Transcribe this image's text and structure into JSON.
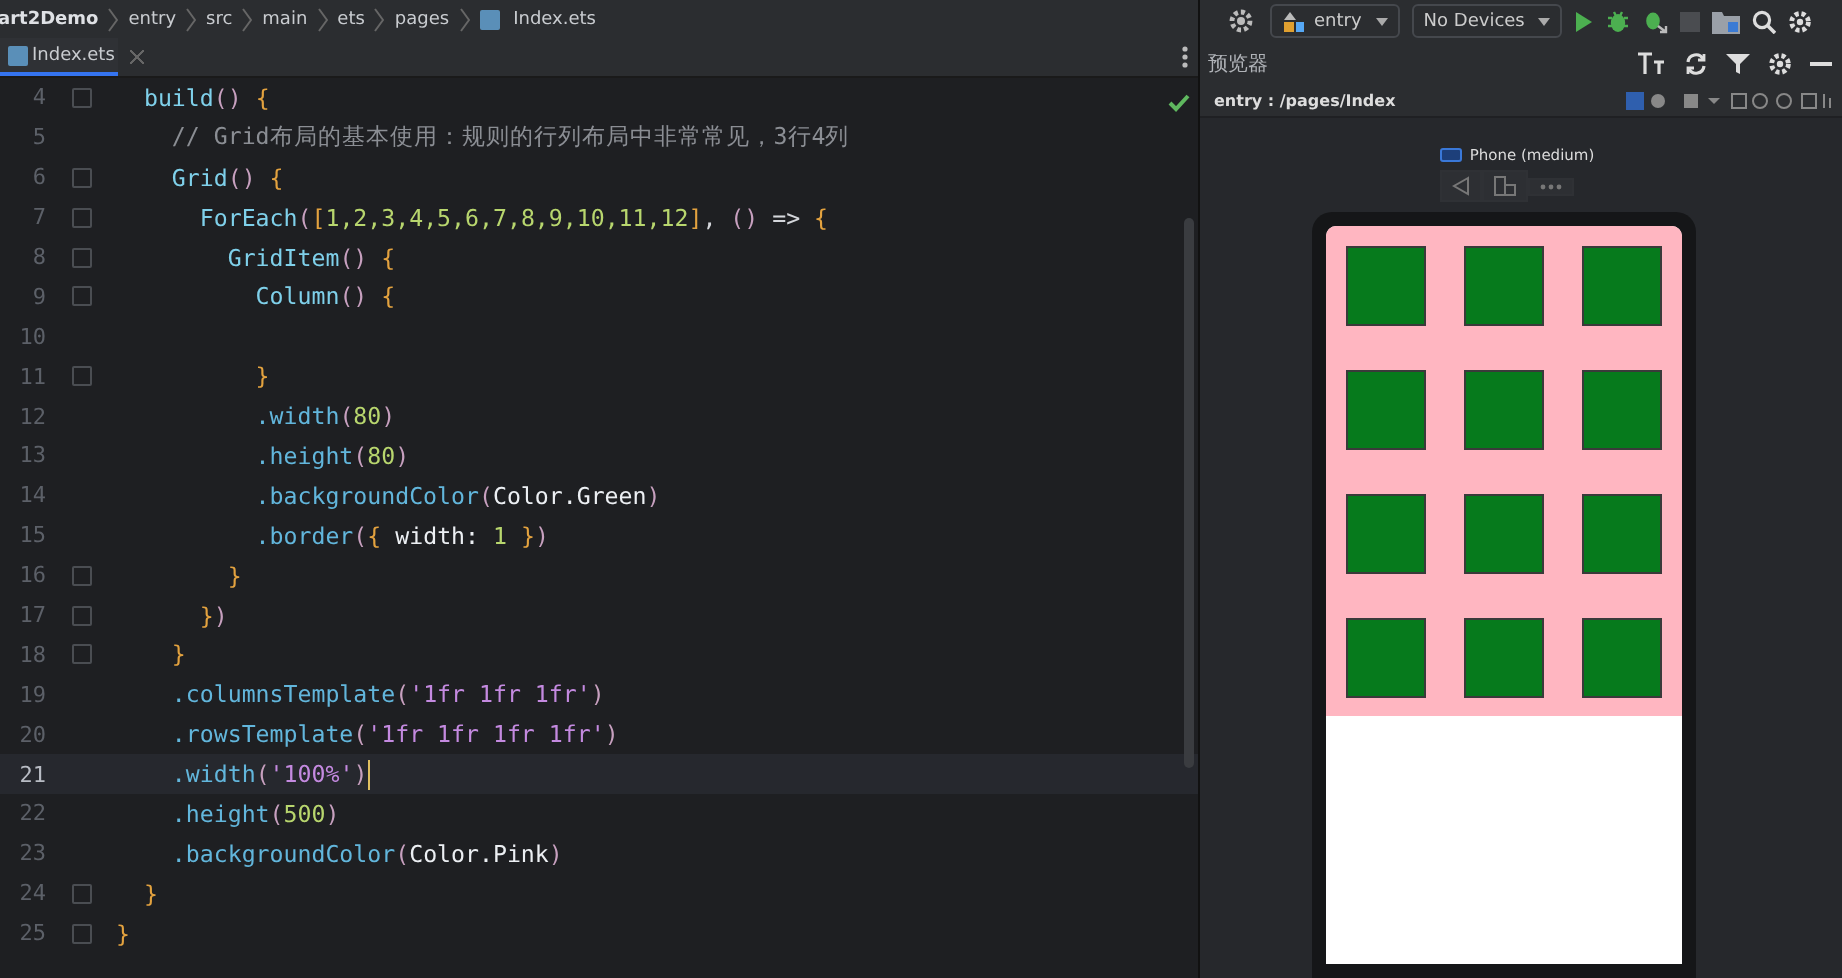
{
  "breadcrumb": [
    "art2Demo",
    "entry",
    "src",
    "main",
    "ets",
    "pages",
    "Index.ets"
  ],
  "tabs": [
    {
      "label": "Index.ets",
      "selected": true
    }
  ],
  "editor": {
    "lines": [
      {
        "number": "4",
        "fold": true,
        "current": false,
        "tokens": [
          {
            "kind": "fn",
            "text": "  build"
          },
          {
            "kind": "paren",
            "text": "() "
          },
          {
            "kind": "brace",
            "text": "{"
          }
        ]
      },
      {
        "number": "5",
        "fold": false,
        "current": false,
        "tokens": [
          {
            "kind": "comment",
            "text": "    // Grid布局的基本使用：规则的行列布局中非常常见，3行4列"
          }
        ]
      },
      {
        "number": "6",
        "fold": true,
        "current": false,
        "tokens": [
          {
            "kind": "fn",
            "text": "    Grid"
          },
          {
            "kind": "paren",
            "text": "() "
          },
          {
            "kind": "brace",
            "text": "{"
          }
        ]
      },
      {
        "number": "7",
        "fold": true,
        "current": false,
        "tokens": [
          {
            "kind": "fn",
            "text": "      ForEach"
          },
          {
            "kind": "paren",
            "text": "("
          },
          {
            "kind": "brace",
            "text": "["
          },
          {
            "kind": "num",
            "text": "1,2,3,4,5,6,7,8,9,10,11,12"
          },
          {
            "kind": "brace",
            "text": "]"
          },
          {
            "kind": "plain",
            "text": ", "
          },
          {
            "kind": "paren",
            "text": "()"
          },
          {
            "kind": "plain",
            "text": " => "
          },
          {
            "kind": "brace",
            "text": "{"
          }
        ]
      },
      {
        "number": "8",
        "fold": true,
        "current": false,
        "tokens": [
          {
            "kind": "fn",
            "text": "        GridItem"
          },
          {
            "kind": "paren",
            "text": "() "
          },
          {
            "kind": "brace",
            "text": "{"
          }
        ]
      },
      {
        "number": "9",
        "fold": true,
        "current": false,
        "tokens": [
          {
            "kind": "fn",
            "text": "          Column"
          },
          {
            "kind": "paren",
            "text": "() "
          },
          {
            "kind": "brace",
            "text": "{"
          }
        ]
      },
      {
        "number": "10",
        "fold": false,
        "current": false
      },
      {
        "number": "11",
        "fold": true,
        "current": false,
        "tokens": [
          {
            "kind": "brace",
            "text": "          }"
          }
        ]
      },
      {
        "number": "12",
        "fold": false,
        "current": false,
        "tokens": [
          {
            "kind": "method",
            "text": "          .width"
          },
          {
            "kind": "paren",
            "text": "("
          },
          {
            "kind": "num",
            "text": "80"
          },
          {
            "kind": "paren",
            "text": ")"
          }
        ]
      },
      {
        "number": "13",
        "fold": false,
        "current": false,
        "tokens": [
          {
            "kind": "method",
            "text": "          .height"
          },
          {
            "kind": "paren",
            "text": "("
          },
          {
            "kind": "num",
            "text": "80"
          },
          {
            "kind": "paren",
            "text": ")"
          }
        ]
      },
      {
        "number": "14",
        "fold": false,
        "current": false,
        "tokens": [
          {
            "kind": "method",
            "text": "          .backgroundColor"
          },
          {
            "kind": "paren",
            "text": "("
          },
          {
            "kind": "ident",
            "text": "Color.Green"
          },
          {
            "kind": "paren",
            "text": ")"
          }
        ]
      },
      {
        "number": "15",
        "fold": false,
        "current": false,
        "tokens": [
          {
            "kind": "method",
            "text": "          .border"
          },
          {
            "kind": "paren",
            "text": "("
          },
          {
            "kind": "brace",
            "text": "{ "
          },
          {
            "kind": "ident",
            "text": "width: "
          },
          {
            "kind": "num",
            "text": "1"
          },
          {
            "kind": "brace",
            "text": " }"
          },
          {
            "kind": "paren",
            "text": ")"
          }
        ]
      },
      {
        "number": "16",
        "fold": true,
        "current": false,
        "tokens": [
          {
            "kind": "brace",
            "text": "        }"
          }
        ]
      },
      {
        "number": "17",
        "fold": true,
        "current": false,
        "tokens": [
          {
            "kind": "brace",
            "text": "      }"
          },
          {
            "kind": "paren",
            "text": ")"
          }
        ]
      },
      {
        "number": "18",
        "fold": true,
        "current": false,
        "tokens": [
          {
            "kind": "brace",
            "text": "    }"
          }
        ]
      },
      {
        "number": "19",
        "fold": false,
        "current": false,
        "tokens": [
          {
            "kind": "method",
            "text": "    .columnsTemplate"
          },
          {
            "kind": "paren",
            "text": "("
          },
          {
            "kind": "str",
            "text": "'1fr 1fr 1fr'"
          },
          {
            "kind": "paren",
            "text": ")"
          }
        ]
      },
      {
        "number": "20",
        "fold": false,
        "current": false,
        "tokens": [
          {
            "kind": "method",
            "text": "    .rowsTemplate"
          },
          {
            "kind": "paren",
            "text": "("
          },
          {
            "kind": "str",
            "text": "'1fr 1fr 1fr 1fr'"
          },
          {
            "kind": "paren",
            "text": ")"
          }
        ]
      },
      {
        "number": "21",
        "fold": false,
        "current": true,
        "tokens": [
          {
            "kind": "method",
            "text": "    .width"
          },
          {
            "kind": "paren",
            "text": "("
          },
          {
            "kind": "str",
            "text": "'100%'"
          },
          {
            "kind": "paren",
            "text": ")"
          }
        ]
      },
      {
        "number": "22",
        "fold": false,
        "current": false,
        "tokens": [
          {
            "kind": "method",
            "text": "    .height"
          },
          {
            "kind": "paren",
            "text": "("
          },
          {
            "kind": "num",
            "text": "500"
          },
          {
            "kind": "paren",
            "text": ")"
          }
        ]
      },
      {
        "number": "23",
        "fold": false,
        "current": false,
        "tokens": [
          {
            "kind": "method",
            "text": "    .backgroundColor"
          },
          {
            "kind": "paren",
            "text": "("
          },
          {
            "kind": "ident",
            "text": "Color.Pink"
          },
          {
            "kind": "paren",
            "text": ")"
          }
        ]
      },
      {
        "number": "24",
        "fold": true,
        "current": false,
        "tokens": [
          {
            "kind": "brace",
            "text": "  }"
          }
        ]
      },
      {
        "number": "25",
        "fold": true,
        "current": false,
        "tokens": [
          {
            "kind": "brace",
            "text": "}"
          }
        ]
      }
    ]
  },
  "toolbar": {
    "module": "entry",
    "device": "No Devices"
  },
  "previewer": {
    "title": "预览器",
    "path": "entry : /pages/Index",
    "device_name": "Phone (medium)"
  }
}
